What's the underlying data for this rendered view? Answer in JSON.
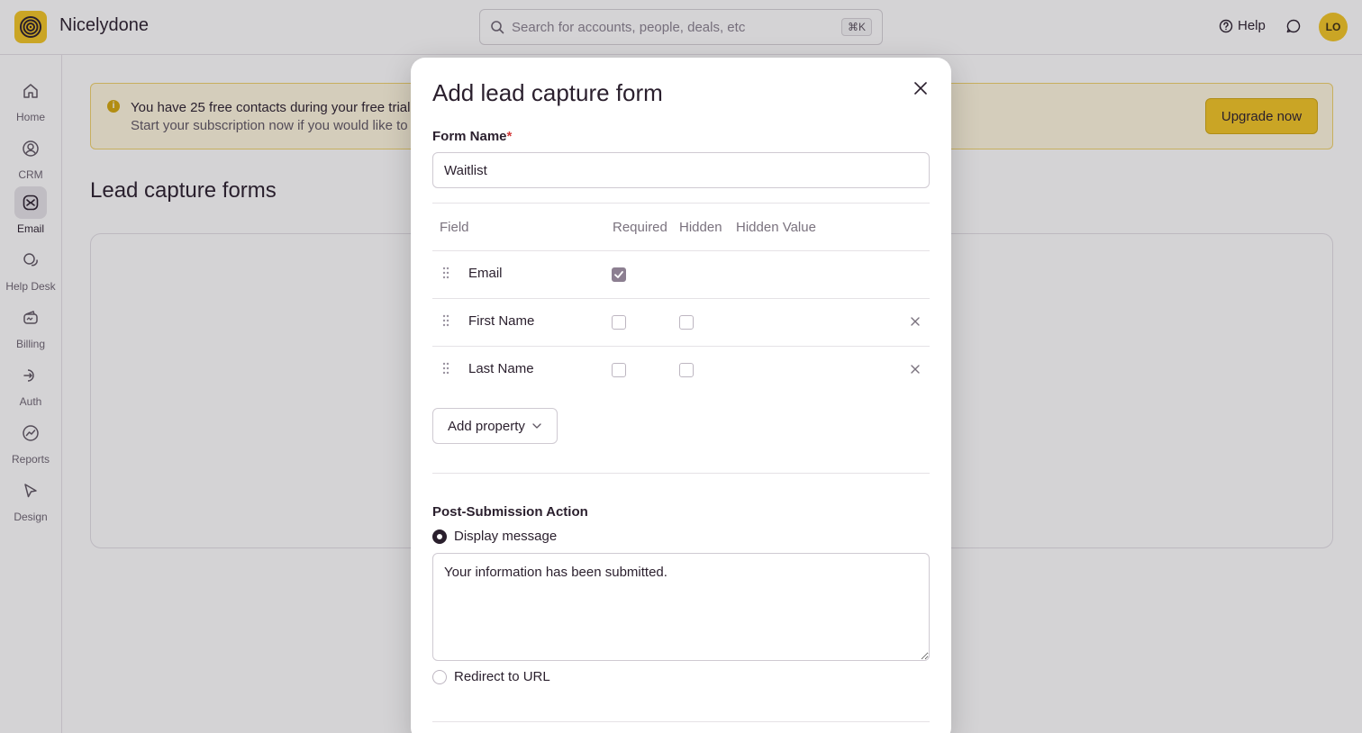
{
  "app": {
    "name": "Nicelydone"
  },
  "search": {
    "placeholder": "Search for accounts, people, deals, etc",
    "shortcut": "⌘K"
  },
  "header": {
    "help_label": "Help",
    "avatar_initials": "LO"
  },
  "sidebar": {
    "items": [
      {
        "label": "Home",
        "icon": "home-icon",
        "active": false
      },
      {
        "label": "CRM",
        "icon": "person-icon",
        "active": false
      },
      {
        "label": "Email",
        "icon": "email-icon",
        "active": true
      },
      {
        "label": "Help Desk",
        "icon": "chat-bubbles-icon",
        "active": false
      },
      {
        "label": "Billing",
        "icon": "wallet-icon",
        "active": false
      },
      {
        "label": "Auth",
        "icon": "key-icon",
        "active": false
      },
      {
        "label": "Reports",
        "icon": "chart-icon",
        "active": false
      },
      {
        "label": "Design",
        "icon": "cursor-icon",
        "active": false
      }
    ]
  },
  "banner": {
    "line1": "You have 25 free contacts during your free trial",
    "line2": "Start your subscription now if you would like to i",
    "upgrade_label": "Upgrade now"
  },
  "page": {
    "title": "Lead capture forms"
  },
  "modal": {
    "title": "Add lead capture form",
    "form_name_label": "Form Name",
    "form_name_required_mark": "*",
    "form_name_value": "Waitlist",
    "columns": {
      "field": "Field",
      "required": "Required",
      "hidden": "Hidden",
      "hidden_value": "Hidden Value"
    },
    "fields": [
      {
        "name": "Email",
        "required": true,
        "hidden": null,
        "removable": false
      },
      {
        "name": "First Name",
        "required": false,
        "hidden": false,
        "removable": true
      },
      {
        "name": "Last Name",
        "required": false,
        "hidden": false,
        "removable": true
      }
    ],
    "add_property_label": "Add property",
    "post_submission": {
      "label": "Post-Submission Action",
      "option_display": "Display message",
      "option_redirect": "Redirect to URL",
      "selected": "display",
      "message": "Your information has been submitted."
    }
  },
  "colors": {
    "brand": "#f3c623",
    "text": "#2a1f2d",
    "required": "#d23a3a"
  }
}
